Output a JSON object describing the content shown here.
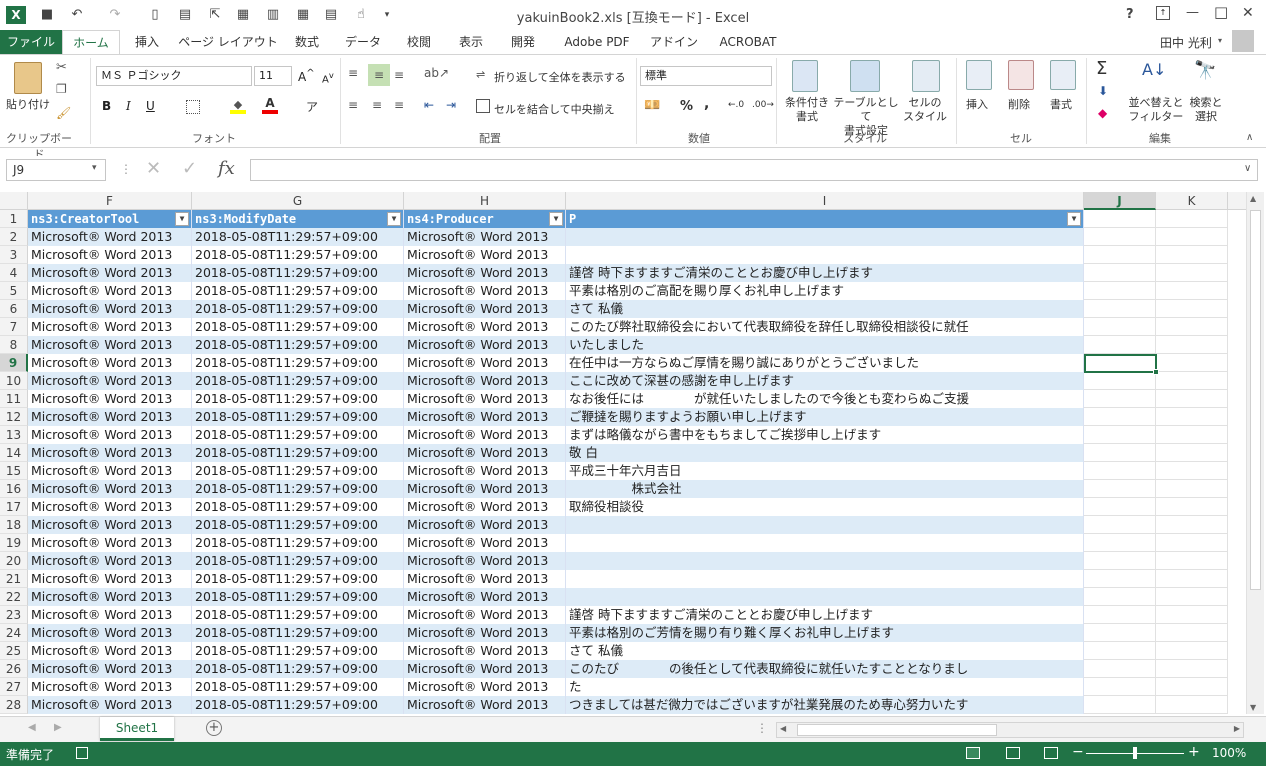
{
  "window": {
    "title": "yakuinBook2.xls  [互換モード] - Excel",
    "help": "?",
    "minimize": "—",
    "restore": "□",
    "close": "✕"
  },
  "tabs": [
    "ファイル",
    "ホーム",
    "挿入",
    "ページ レイアウト",
    "数式",
    "データ",
    "校閲",
    "表示",
    "開発",
    "Adobe PDF",
    "アドイン",
    "ACROBAT"
  ],
  "user": {
    "name": "田中 光利"
  },
  "ribbon": {
    "clipboard": {
      "paste": "貼り付け",
      "label": "クリップボード"
    },
    "font": {
      "name": "ＭＳ Ｐゴシック",
      "size": "11",
      "label": "フォント",
      "bold": "B",
      "italic": "I",
      "underline": "U"
    },
    "alignment": {
      "wrap": "折り返して全体を表示する",
      "merge": "セルを結合して中央揃え",
      "label": "配置"
    },
    "number": {
      "format": "標準",
      "percent": "%",
      "comma": ",",
      "label": "数値"
    },
    "styles": {
      "conditional": "条件付き\n書式",
      "table": "テーブルとして\n書式設定",
      "cell": "セルの\nスタイル",
      "label": "スタイル"
    },
    "cells": {
      "insert": "挿入",
      "delete": "削除",
      "format": "書式",
      "label": "セル"
    },
    "editing": {
      "sort": "並べ替えと\nフィルター",
      "find": "検索と\n選択",
      "label": "編集"
    }
  },
  "formula_bar": {
    "name_box": "J9",
    "fx": "fx",
    "value": ""
  },
  "columns": [
    {
      "letter": "F"
    },
    {
      "letter": "G"
    },
    {
      "letter": "H"
    },
    {
      "letter": "I"
    },
    {
      "letter": "J"
    },
    {
      "letter": "K"
    }
  ],
  "header_row": [
    "ns3:CreatorTool",
    "ns3:ModifyDate",
    "ns4:Producer",
    "P"
  ],
  "rows": [
    {
      "n": "2",
      "f": "Microsoft® Word 2013",
      "g": "2018-05-08T11:29:57+09:00",
      "h": "Microsoft® Word 2013",
      "i": ""
    },
    {
      "n": "3",
      "f": "Microsoft® Word 2013",
      "g": "2018-05-08T11:29:57+09:00",
      "h": "Microsoft® Word 2013",
      "i": ""
    },
    {
      "n": "4",
      "f": "Microsoft® Word 2013",
      "g": "2018-05-08T11:29:57+09:00",
      "h": "Microsoft® Word 2013",
      "i": "謹啓 時下ますますご清栄のこととお慶び申し上げます"
    },
    {
      "n": "5",
      "f": "Microsoft® Word 2013",
      "g": "2018-05-08T11:29:57+09:00",
      "h": "Microsoft® Word 2013",
      "i": "平素は格別のご高配を賜り厚くお礼申し上げます"
    },
    {
      "n": "6",
      "f": "Microsoft® Word 2013",
      "g": "2018-05-08T11:29:57+09:00",
      "h": "Microsoft® Word 2013",
      "i": "さて 私儀"
    },
    {
      "n": "7",
      "f": "Microsoft® Word 2013",
      "g": "2018-05-08T11:29:57+09:00",
      "h": "Microsoft® Word 2013",
      "i": "このたび弊社取締役会において代表取締役を辞任し取締役相談役に就任"
    },
    {
      "n": "8",
      "f": "Microsoft® Word 2013",
      "g": "2018-05-08T11:29:57+09:00",
      "h": "Microsoft® Word 2013",
      "i": "いたしました"
    },
    {
      "n": "9",
      "f": "Microsoft® Word 2013",
      "g": "2018-05-08T11:29:57+09:00",
      "h": "Microsoft® Word 2013",
      "i": "在任中は一方ならぬご厚情を賜り誠にありがとうございました"
    },
    {
      "n": "10",
      "f": "Microsoft® Word 2013",
      "g": "2018-05-08T11:29:57+09:00",
      "h": "Microsoft® Word 2013",
      "i": "ここに改めて深甚の感謝を申し上げます"
    },
    {
      "n": "11",
      "f": "Microsoft® Word 2013",
      "g": "2018-05-08T11:29:57+09:00",
      "h": "Microsoft® Word 2013",
      "i": "なお後任には　　　　が就任いたしましたので今後とも変わらぬご支援"
    },
    {
      "n": "12",
      "f": "Microsoft® Word 2013",
      "g": "2018-05-08T11:29:57+09:00",
      "h": "Microsoft® Word 2013",
      "i": "ご鞭撻を賜りますようお願い申し上げます"
    },
    {
      "n": "13",
      "f": "Microsoft® Word 2013",
      "g": "2018-05-08T11:29:57+09:00",
      "h": "Microsoft® Word 2013",
      "i": "まずは略儀ながら書中をもちましてご挨拶申し上げます"
    },
    {
      "n": "14",
      "f": "Microsoft® Word 2013",
      "g": "2018-05-08T11:29:57+09:00",
      "h": "Microsoft® Word 2013",
      "i": "敬 白"
    },
    {
      "n": "15",
      "f": "Microsoft® Word 2013",
      "g": "2018-05-08T11:29:57+09:00",
      "h": "Microsoft® Word 2013",
      "i": "平成三十年六月吉日"
    },
    {
      "n": "16",
      "f": "Microsoft® Word 2013",
      "g": "2018-05-08T11:29:57+09:00",
      "h": "Microsoft® Word 2013",
      "i": "　　　　　株式会社"
    },
    {
      "n": "17",
      "f": "Microsoft® Word 2013",
      "g": "2018-05-08T11:29:57+09:00",
      "h": "Microsoft® Word 2013",
      "i": "取締役相談役"
    },
    {
      "n": "18",
      "f": "Microsoft® Word 2013",
      "g": "2018-05-08T11:29:57+09:00",
      "h": "Microsoft® Word 2013",
      "i": ""
    },
    {
      "n": "19",
      "f": "Microsoft® Word 2013",
      "g": "2018-05-08T11:29:57+09:00",
      "h": "Microsoft® Word 2013",
      "i": ""
    },
    {
      "n": "20",
      "f": "Microsoft® Word 2013",
      "g": "2018-05-08T11:29:57+09:00",
      "h": "Microsoft® Word 2013",
      "i": ""
    },
    {
      "n": "21",
      "f": "Microsoft® Word 2013",
      "g": "2018-05-08T11:29:57+09:00",
      "h": "Microsoft® Word 2013",
      "i": ""
    },
    {
      "n": "22",
      "f": "Microsoft® Word 2013",
      "g": "2018-05-08T11:29:57+09:00",
      "h": "Microsoft® Word 2013",
      "i": ""
    },
    {
      "n": "23",
      "f": "Microsoft® Word 2013",
      "g": "2018-05-08T11:29:57+09:00",
      "h": "Microsoft® Word 2013",
      "i": "謹啓 時下ますますご清栄のこととお慶び申し上げます"
    },
    {
      "n": "24",
      "f": "Microsoft® Word 2013",
      "g": "2018-05-08T11:29:57+09:00",
      "h": "Microsoft® Word 2013",
      "i": "平素は格別のご芳情を賜り有り難く厚くお礼申し上げます"
    },
    {
      "n": "25",
      "f": "Microsoft® Word 2013",
      "g": "2018-05-08T11:29:57+09:00",
      "h": "Microsoft® Word 2013",
      "i": "さて 私儀"
    },
    {
      "n": "26",
      "f": "Microsoft® Word 2013",
      "g": "2018-05-08T11:29:57+09:00",
      "h": "Microsoft® Word 2013",
      "i": "このたび　　　　の後任として代表取締役に就任いたすこととなりまし"
    },
    {
      "n": "27",
      "f": "Microsoft® Word 2013",
      "g": "2018-05-08T11:29:57+09:00",
      "h": "Microsoft® Word 2013",
      "i": "た"
    },
    {
      "n": "28",
      "f": "Microsoft® Word 2013",
      "g": "2018-05-08T11:29:57+09:00",
      "h": "Microsoft® Word 2013",
      "i": "つきましては甚だ微力ではございますが社業発展のため専心努力いたす"
    }
  ],
  "sheet_tabs": [
    "Sheet1"
  ],
  "status": {
    "ready": "準備完了",
    "zoom": "100%"
  }
}
